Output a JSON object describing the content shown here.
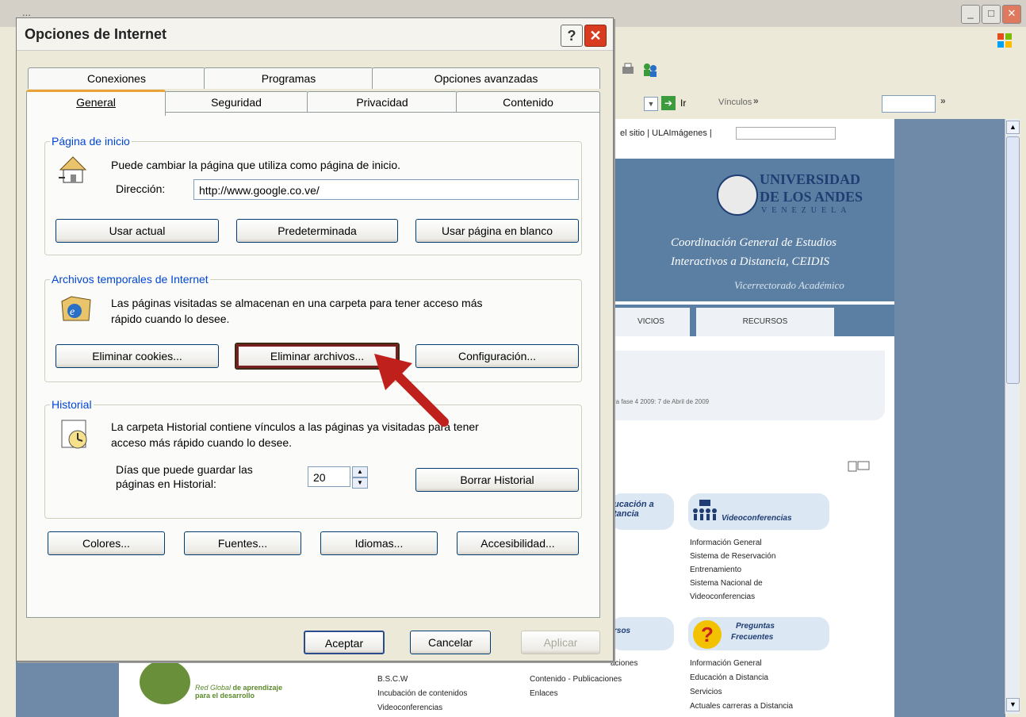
{
  "browser": {
    "window_title": "...",
    "links_label": "Vínculos",
    "go_label": "Ir",
    "site_search_text": "el sitio | ULAImágenes |",
    "university_name_1": "UNIVERSIDAD",
    "university_name_2": "DE LOS ANDES",
    "university_country": "VENEZUELA",
    "banner_line_1": "Coordinación General de Estudios",
    "banner_line_2": "Interactivos a Distancia, CEIDIS",
    "banner_line_3": "Vicerrectorado Académico",
    "nav_tab_servicios": "VICIOS",
    "nav_tab_recursos": "RECURSOS",
    "date_text": "ra fase 4 2009: 7 de Abril de 2009",
    "section_educacion": "ucación a\ntancia",
    "section_videoconf": "Videoconferencias",
    "videoconf_items": [
      "Información General",
      "Sistema de Reservación",
      "Entrenamiento",
      "Sistema Nacional de",
      "Videoconferencias"
    ],
    "section_recursos": "rsos",
    "section_faq_1": "Preguntas",
    "section_faq_2": "Frecuentes",
    "faq_items": [
      "Información General",
      "Educación a Distancia",
      "Servicios",
      "Actuales carreras a Distancia"
    ],
    "col1_items": [
      "B.S.C.W",
      "Incubación de contenidos",
      "Videoconferencias"
    ],
    "col2_items": [
      "aciones",
      "Contenido - Publicaciones",
      "Enlaces"
    ],
    "red_global_1": "Red Global",
    "red_global_2": "de aprendizaje",
    "red_global_3": "para el desarrollo"
  },
  "dialog": {
    "title": "Opciones de Internet",
    "help_label": "?",
    "close_label": "✕",
    "tabs_row1": [
      "Conexiones",
      "Programas",
      "Opciones avanzadas"
    ],
    "tabs_row2": [
      "General",
      "Seguridad",
      "Privacidad",
      "Contenido"
    ],
    "home": {
      "legend": "Página de inicio",
      "description": "Puede cambiar la página que utiliza como página de inicio.",
      "address_label": "Dirección:",
      "address_value": "http://www.google.co.ve/",
      "btn_current": "Usar actual",
      "btn_default": "Predeterminada",
      "btn_blank": "Usar página en blanco"
    },
    "temp": {
      "legend": "Archivos temporales de Internet",
      "description_1": "Las páginas visitadas se almacenan en una carpeta para tener acceso más",
      "description_2": "rápido cuando lo desee.",
      "btn_cookies": "Eliminar cookies...",
      "btn_files": "Eliminar archivos...",
      "btn_settings": "Configuración..."
    },
    "history": {
      "legend": "Historial",
      "description_1": "La carpeta Historial contiene vínculos a las páginas ya visitadas para tener",
      "description_2": "acceso más rápido cuando lo desee.",
      "days_label_1": "Días que puede guardar las",
      "days_label_2": "páginas en Historial:",
      "days_value": "20",
      "btn_clear": "Borrar Historial"
    },
    "bottom": {
      "btn_colors": "Colores...",
      "btn_fonts": "Fuentes...",
      "btn_languages": "Idiomas...",
      "btn_accessibility": "Accesibilidad..."
    },
    "footer": {
      "btn_ok": "Aceptar",
      "btn_cancel": "Cancelar",
      "btn_apply": "Aplicar"
    }
  },
  "colors": {
    "accent_blue": "#0046d5",
    "arrow_red": "#c0201c",
    "close_red": "#d83b1f"
  }
}
